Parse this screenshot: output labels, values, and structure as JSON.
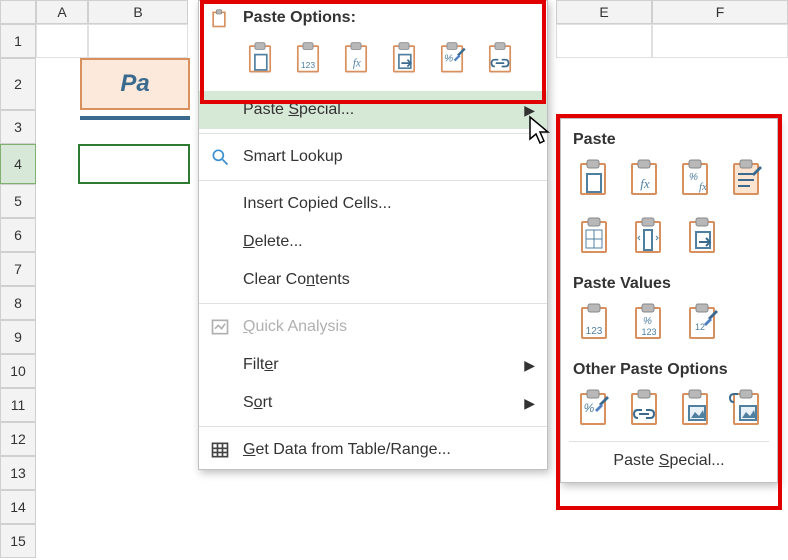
{
  "columns": {
    "A": "A",
    "B": "B",
    "E": "E",
    "F": "F"
  },
  "rows": [
    "1",
    "2",
    "3",
    "4",
    "5",
    "6",
    "7",
    "8",
    "9",
    "10",
    "11",
    "12",
    "13",
    "14",
    "15"
  ],
  "title_cell_fragment": "Pa",
  "context_menu": {
    "paste_options_label": "Paste Options:",
    "paste_icons": [
      "paste-all",
      "paste-values",
      "paste-formulas",
      "paste-transpose",
      "paste-formatting",
      "paste-link"
    ],
    "paste_special": "Paste Special...",
    "smart_lookup": "Smart Lookup",
    "insert_copied": "Insert Copied Cells...",
    "delete": "Delete...",
    "clear_contents": "Clear Contents",
    "quick_analysis": "Quick Analysis",
    "filter": "Filter",
    "sort": "Sort",
    "get_data": "Get Data from Table/Range..."
  },
  "submenu": {
    "paste_heading": "Paste",
    "paste_row1": [
      "paste-all",
      "paste-formulas",
      "paste-formulas-number-format",
      "paste-keep-source"
    ],
    "paste_row2": [
      "paste-no-borders",
      "paste-keep-col-width",
      "paste-transpose"
    ],
    "values_heading": "Paste Values",
    "values_row": [
      "paste-values",
      "paste-values-number-format",
      "paste-values-source-format"
    ],
    "other_heading": "Other Paste Options",
    "other_row": [
      "paste-formatting",
      "paste-link",
      "paste-picture",
      "paste-linked-picture"
    ],
    "paste_special_link": "Paste Special..."
  }
}
